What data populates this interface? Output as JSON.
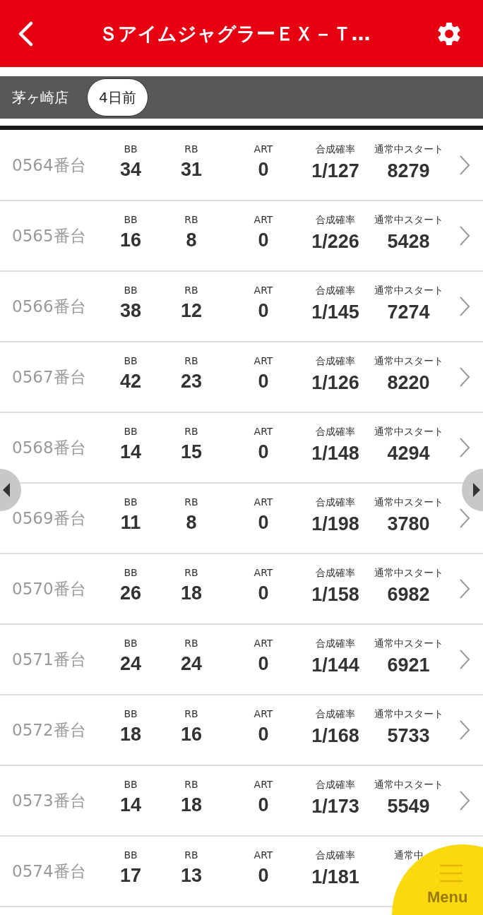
{
  "header": {
    "title": "ＳアイムジャグラーＥＸ－Ｔ…"
  },
  "filter_bar": {
    "store": "茅ヶ崎店",
    "day_chip": "4日前"
  },
  "rows": [
    {
      "machine": "0564番台",
      "chevron": true,
      "stats": [
        {
          "label": "BB",
          "value": "34"
        },
        {
          "label": "RB",
          "value": "31"
        },
        {
          "label": "ART",
          "value": "0"
        },
        {
          "label": "合成確率",
          "value": "1/127"
        },
        {
          "label": "通常中スタート",
          "value": "8279"
        }
      ]
    },
    {
      "machine": "0565番台",
      "chevron": true,
      "stats": [
        {
          "label": "BB",
          "value": "16"
        },
        {
          "label": "RB",
          "value": "8"
        },
        {
          "label": "ART",
          "value": "0"
        },
        {
          "label": "合成確率",
          "value": "1/226"
        },
        {
          "label": "通常中スタート",
          "value": "5428"
        }
      ]
    },
    {
      "machine": "0566番台",
      "chevron": true,
      "stats": [
        {
          "label": "BB",
          "value": "38"
        },
        {
          "label": "RB",
          "value": "12"
        },
        {
          "label": "ART",
          "value": "0"
        },
        {
          "label": "合成確率",
          "value": "1/145"
        },
        {
          "label": "通常中スタート",
          "value": "7274"
        }
      ]
    },
    {
      "machine": "0567番台",
      "chevron": true,
      "stats": [
        {
          "label": "BB",
          "value": "42"
        },
        {
          "label": "RB",
          "value": "23"
        },
        {
          "label": "ART",
          "value": "0"
        },
        {
          "label": "合成確率",
          "value": "1/126"
        },
        {
          "label": "通常中スタート",
          "value": "8220"
        }
      ]
    },
    {
      "machine": "0568番台",
      "chevron": true,
      "stats": [
        {
          "label": "BB",
          "value": "14"
        },
        {
          "label": "RB",
          "value": "15"
        },
        {
          "label": "ART",
          "value": "0"
        },
        {
          "label": "合成確率",
          "value": "1/148"
        },
        {
          "label": "通常中スタート",
          "value": "4294"
        }
      ]
    },
    {
      "machine": "0569番台",
      "chevron": true,
      "stats": [
        {
          "label": "BB",
          "value": "11"
        },
        {
          "label": "RB",
          "value": "8"
        },
        {
          "label": "ART",
          "value": "0"
        },
        {
          "label": "合成確率",
          "value": "1/198"
        },
        {
          "label": "通常中スタート",
          "value": "3780"
        }
      ]
    },
    {
      "machine": "0570番台",
      "chevron": true,
      "stats": [
        {
          "label": "BB",
          "value": "26"
        },
        {
          "label": "RB",
          "value": "18"
        },
        {
          "label": "ART",
          "value": "0"
        },
        {
          "label": "合成確率",
          "value": "1/158"
        },
        {
          "label": "通常中スタート",
          "value": "6982"
        }
      ]
    },
    {
      "machine": "0571番台",
      "chevron": true,
      "stats": [
        {
          "label": "BB",
          "value": "24"
        },
        {
          "label": "RB",
          "value": "24"
        },
        {
          "label": "ART",
          "value": "0"
        },
        {
          "label": "合成確率",
          "value": "1/144"
        },
        {
          "label": "通常中スタート",
          "value": "6921"
        }
      ]
    },
    {
      "machine": "0572番台",
      "chevron": true,
      "stats": [
        {
          "label": "BB",
          "value": "18"
        },
        {
          "label": "RB",
          "value": "16"
        },
        {
          "label": "ART",
          "value": "0"
        },
        {
          "label": "合成確率",
          "value": "1/168"
        },
        {
          "label": "通常中スタート",
          "value": "5733"
        }
      ]
    },
    {
      "machine": "0573番台",
      "chevron": true,
      "stats": [
        {
          "label": "BB",
          "value": "14"
        },
        {
          "label": "RB",
          "value": "18"
        },
        {
          "label": "ART",
          "value": "0"
        },
        {
          "label": "合成確率",
          "value": "1/173"
        },
        {
          "label": "通常中スタート",
          "value": "5549"
        }
      ]
    },
    {
      "machine": "0574番台",
      "stats": [
        {
          "label": "BB",
          "value": "17"
        },
        {
          "label": "RB",
          "value": "13"
        },
        {
          "label": "ART",
          "value": "0"
        },
        {
          "label": "合成確率",
          "value": "1/181"
        },
        {
          "label": "通常中"
        }
      ]
    }
  ],
  "menu_button": {
    "label": "Menu"
  }
}
